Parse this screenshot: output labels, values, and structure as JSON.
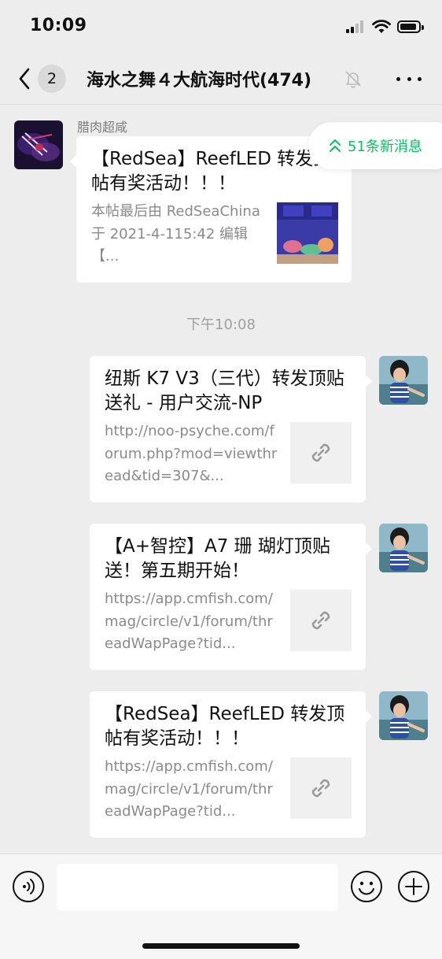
{
  "status_bar": {
    "time": "10:09"
  },
  "navbar": {
    "unread_count": "2",
    "title": "海水之舞４大航海时代(474)"
  },
  "new_messages_pill": {
    "label": "51条新消息"
  },
  "messages": [
    {
      "sender": "腊肉超咸",
      "title": "【RedSea】ReefLED 转发顶帖有奖活动！！！",
      "desc": "本帖最后由 RedSeaChina 于 2021-4-115:42 编辑【..."
    },
    {
      "time_divider": "下午10:08"
    },
    {
      "title": "纽斯 K7 V3（三代）转发顶贴送礼 - 用户交流-NP",
      "desc": "http://noo-psyche.com/forum.php?mod=viewthread&tid=307&..."
    },
    {
      "title": "【A+智控】A7 珊 瑚灯顶贴送！第五期开始！",
      "desc": "https://app.cmfish.com/mag/circle/v1/forum/threadWapPage?tid..."
    },
    {
      "title": "【RedSea】ReefLED 转发顶帖有奖活动！！！",
      "desc": "https://app.cmfish.com/mag/circle/v1/forum/threadWapPage?tid..."
    }
  ],
  "input_bar": {
    "placeholder": ""
  },
  "icons": {
    "back": "chevron-left-icon",
    "mute": "bell-off-icon",
    "more": "more-dots-icon",
    "link": "link-icon",
    "voice": "voice-icon",
    "emoji": "emoji-icon",
    "plus": "plus-icon",
    "up_arrows": "double-chevron-up-icon"
  },
  "colors": {
    "accent": "#07c160",
    "background": "#ededed"
  }
}
